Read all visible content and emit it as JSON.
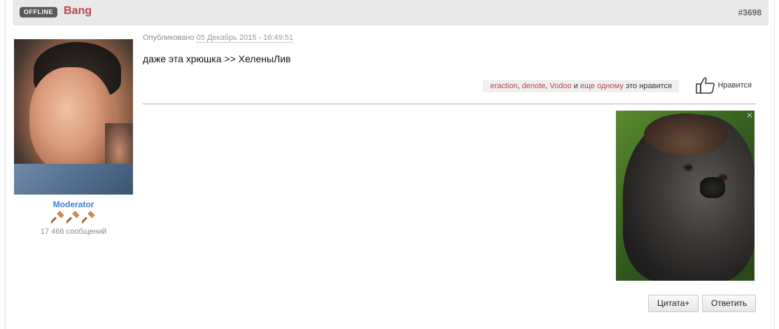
{
  "post": {
    "status": "OFFLINE",
    "author": "Bang",
    "number": "#3698",
    "role": "Moderator",
    "post_count": "17 466 сообщений",
    "published_label": "Опубликовано",
    "published_date": "05 Декабрь 2015 - 16:49:51",
    "message": "даже эта хрюшка >> ХеленыЛив",
    "likes": {
      "user1": "eraction",
      "user2": "denote",
      "user3": "Vodoo",
      "and": "и",
      "more": "еще одному",
      "suffix": "это нравится"
    },
    "like_button": "Нравится",
    "quote_button": "Цитата+",
    "reply_button": "Ответить"
  },
  "icons": {
    "hammer": "gavel-icon",
    "thumbs_up": "thumbs-up-icon"
  },
  "colors": {
    "author": "#b6464a",
    "role": "#3d7fd1",
    "badge": "#5a5a5a"
  }
}
